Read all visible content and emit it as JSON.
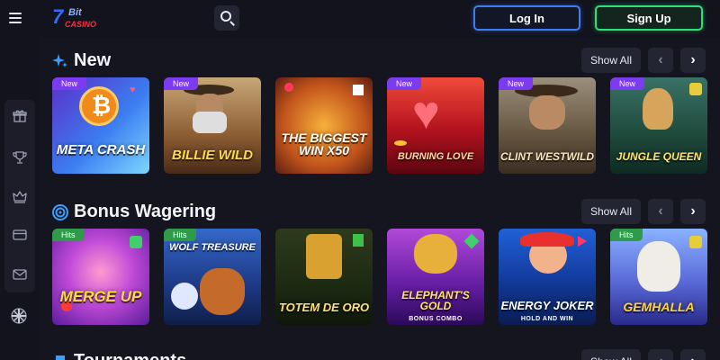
{
  "header": {
    "logo": {
      "number": "7",
      "word": "Bit",
      "sub": "CASINO"
    },
    "login_label": "Log In",
    "signup_label": "Sign Up"
  },
  "sidebar": {
    "items": [
      "gift-icon",
      "trophy-icon",
      "crown-icon",
      "card-icon",
      "mail-icon"
    ],
    "language": "uk-flag-icon"
  },
  "sections": [
    {
      "title": "New",
      "icon": "sparkle-icon",
      "show_all_label": "Show All",
      "games": [
        {
          "name": "META CRASH",
          "badge": "New"
        },
        {
          "name": "BILLIE WILD",
          "badge": "New"
        },
        {
          "name": "THE BIGGEST WIN X50",
          "badge": ""
        },
        {
          "name": "BURNING LOVE",
          "badge": "New"
        },
        {
          "name": "CLINT WESTWILD",
          "badge": "New"
        },
        {
          "name": "JUNGLE QUEEN",
          "badge": "New"
        }
      ]
    },
    {
      "title": "Bonus Wagering",
      "icon": "target-icon",
      "show_all_label": "Show All",
      "games": [
        {
          "name": "MERGE UP",
          "badge": "Hits"
        },
        {
          "name": "WOLF TREASURE",
          "badge": "Hits"
        },
        {
          "name": "TOTEM DE ORO",
          "badge": ""
        },
        {
          "name": "ELEPHANT'S GOLD",
          "sub": "BONUS COMBO",
          "badge": ""
        },
        {
          "name": "ENERGY JOKER",
          "sub": "HOLD AND WIN",
          "badge": ""
        },
        {
          "name": "GEMHALLA",
          "badge": "Hits"
        }
      ]
    },
    {
      "title": "Tournaments",
      "icon": "trophy-icon",
      "show_all_label": "Show All"
    }
  ],
  "colors": {
    "background": "#14151f",
    "accent_blue": "#3d7cf4",
    "accent_green": "#2ce277",
    "badge_new": "#7b3cf0",
    "badge_hits": "#2e9a4a"
  }
}
